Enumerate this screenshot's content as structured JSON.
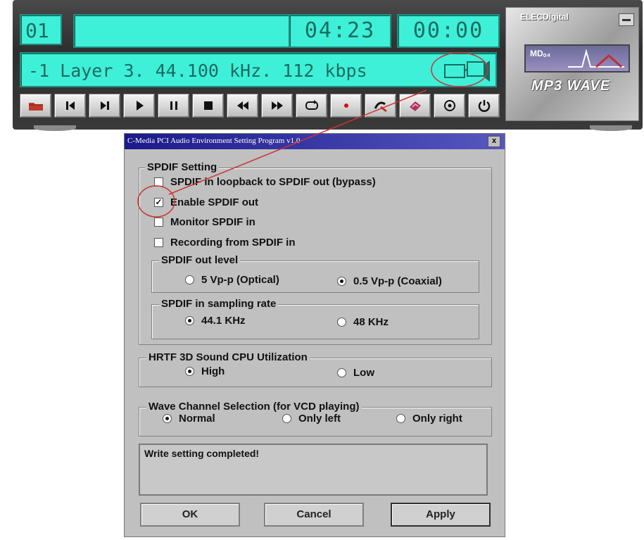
{
  "player": {
    "track_number": "01",
    "song_title": "",
    "total_time": "04:23",
    "elapsed_time": "00:00",
    "info": "-1 Layer 3. 44.100 kHz. 112 kbps",
    "brand": "ELECDigital",
    "logo_text": "MDₒ₄",
    "product_name": "MP3 WAVE",
    "controls": [
      "open-folder",
      "previous",
      "next",
      "play",
      "pause",
      "stop",
      "rewind",
      "fast-forward",
      "repeat",
      "record",
      "spdif-settings",
      "equalizer",
      "options",
      "power"
    ]
  },
  "dialog": {
    "title": "C-Media PCI Audio Environment Setting Program v1.0",
    "close_label": "x",
    "spdif_setting": {
      "legend": "SPDIF Setting",
      "loopback_label": "SPDIF in loopback to SPDIF out (bypass)",
      "loopback_checked": false,
      "enable_out_label": "Enable SPDIF out",
      "enable_out_checked": true,
      "monitor_label": "Monitor SPDIF in",
      "monitor_checked": false,
      "recording_label": "Recording from SPDIF in",
      "recording_checked": false
    },
    "out_level": {
      "legend": "SPDIF out level",
      "optical_label": "5 Vp-p (Optical)",
      "coaxial_label": "0.5 Vp-p (Coaxial)",
      "selected": "coaxial"
    },
    "sampling_rate": {
      "legend": "SPDIF in sampling rate",
      "r441_label": "44.1 KHz",
      "r48_label": "48 KHz",
      "selected": "44.1"
    },
    "hrtf": {
      "legend": "HRTF 3D Sound CPU Utilization",
      "high_label": "High",
      "low_label": "Low",
      "selected": "high"
    },
    "wave_channel": {
      "legend": "Wave Channel Selection (for VCD playing)",
      "normal_label": "Normal",
      "left_label": "Only left",
      "right_label": "Only right",
      "selected": "normal"
    },
    "status_text": "Write setting completed!",
    "ok_label": "OK",
    "cancel_label": "Cancel",
    "apply_label": "Apply"
  },
  "colors": {
    "lcd_background": "#3ff0d8",
    "lcd_text": "#1a6b62",
    "title_bar": "#1a1a8a",
    "annotation": "#cc3333"
  }
}
